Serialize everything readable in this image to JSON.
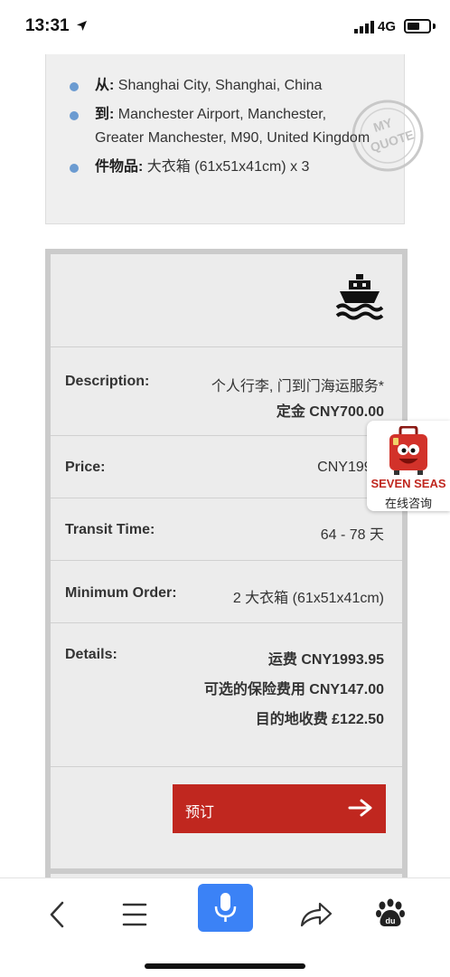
{
  "status_bar": {
    "time": "13:31",
    "network": "4G",
    "battery_level": 0.6
  },
  "shipment_info": {
    "items": [
      {
        "label": "从:",
        "value": "Shanghai City, Shanghai, China"
      },
      {
        "label": "到:",
        "value": "Manchester Airport, Manchester, Greater Manchester, M90, United Kingdom"
      },
      {
        "label": "件物品:",
        "value": "大衣箱 (61x51x41cm) x 3"
      }
    ],
    "stamp_text": "MY QUOTE"
  },
  "quote_card": {
    "transport_icon": "ship-icon",
    "description": {
      "label": "Description:",
      "value": "个人行李, 门到门海运服务*",
      "deposit": "定金 CNY700.00"
    },
    "price": {
      "label": "Price:",
      "value": "CNY1993."
    },
    "transit_time": {
      "label": "Transit Time:",
      "value": "64 - 78 天"
    },
    "minimum_order": {
      "label": "Minimum Order:",
      "value": "2 大衣箱 (61x51x41cm)"
    },
    "details": {
      "label": "Details:",
      "lines": [
        "运费 CNY1993.95",
        "可选的保险费用 CNY147.00",
        "目的地收费 £122.50"
      ]
    },
    "book_button": {
      "label": "预订",
      "icon": "arrow-right-icon"
    }
  },
  "widget": {
    "brand": "SEVEN SEAS",
    "subtitle": "在线咨询",
    "icon": "suitcase-mascot-icon"
  },
  "bottom_bar": {
    "buttons": [
      "back-icon",
      "menu-icon",
      "microphone-icon",
      "share-icon",
      "baidu-paw-icon"
    ],
    "baidu_text": "du"
  },
  "colors": {
    "accent_red": "#c0271f",
    "bullet_blue": "#6b9bd1",
    "mic_blue": "#3b82f6",
    "panel_gray": "#ececec"
  }
}
